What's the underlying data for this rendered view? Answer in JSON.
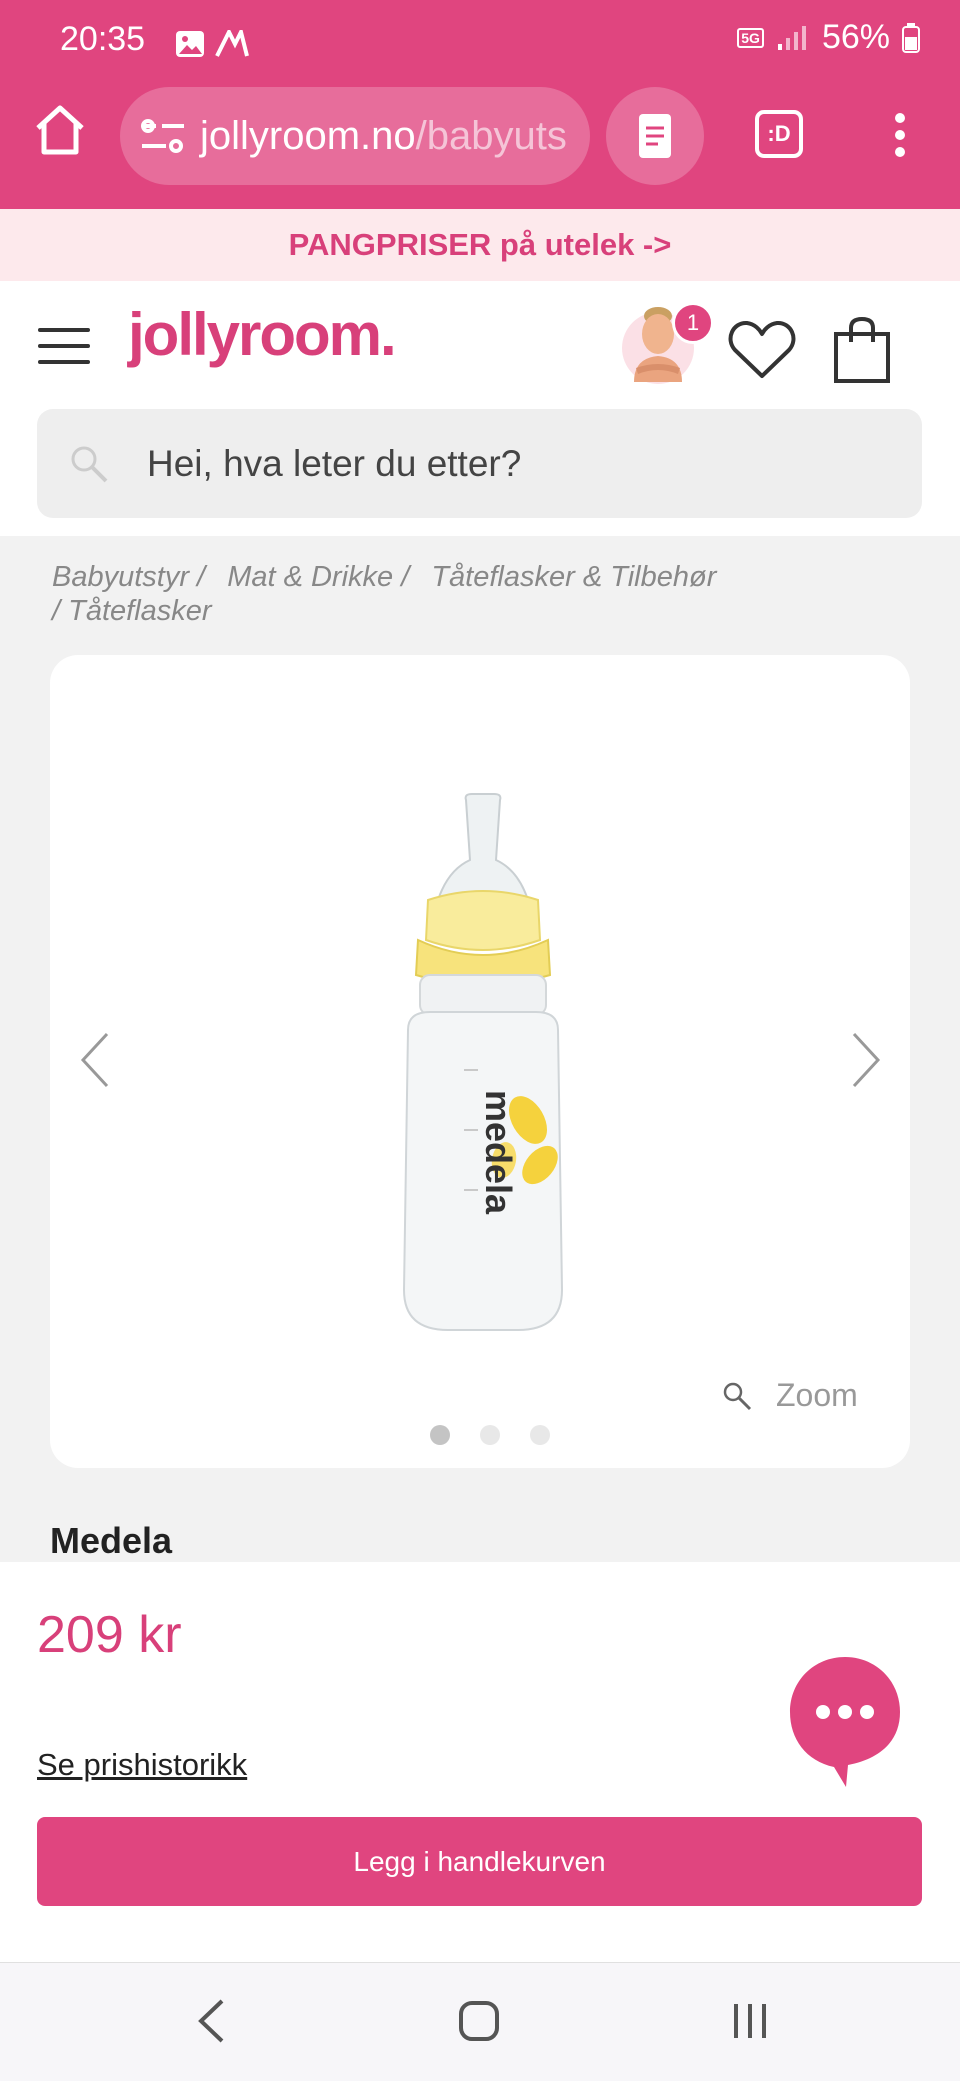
{
  "status_bar": {
    "time": "20:35",
    "network": "5G",
    "battery": "56%"
  },
  "browser": {
    "url_domain": "jollyroom.no",
    "url_path": "/babyuts",
    "tabs_label": ":D"
  },
  "promo": {
    "text": "PANGPRISER på utelek ->"
  },
  "header": {
    "logo": "jollyroom.",
    "cart_badge": "1"
  },
  "search": {
    "placeholder": "Hei, hva leter du etter?"
  },
  "breadcrumb": {
    "items": [
      "Babyutstyr /",
      "Mat & Drikke /",
      "Tåteflasker & Tilbehør",
      "/  Tåteflasker"
    ]
  },
  "product": {
    "zoom_label": "Zoom",
    "brand": "Medela",
    "price": "209 kr",
    "price_history_label": "Se prishistorikk",
    "add_to_cart_label": "Legg i handlekurven",
    "image_count": 3,
    "active_image": 1,
    "image_label": "medela"
  },
  "colors": {
    "brand_pink": "#e0457f",
    "promo_bg": "#fde9ec",
    "price_pink": "#d8407a"
  }
}
